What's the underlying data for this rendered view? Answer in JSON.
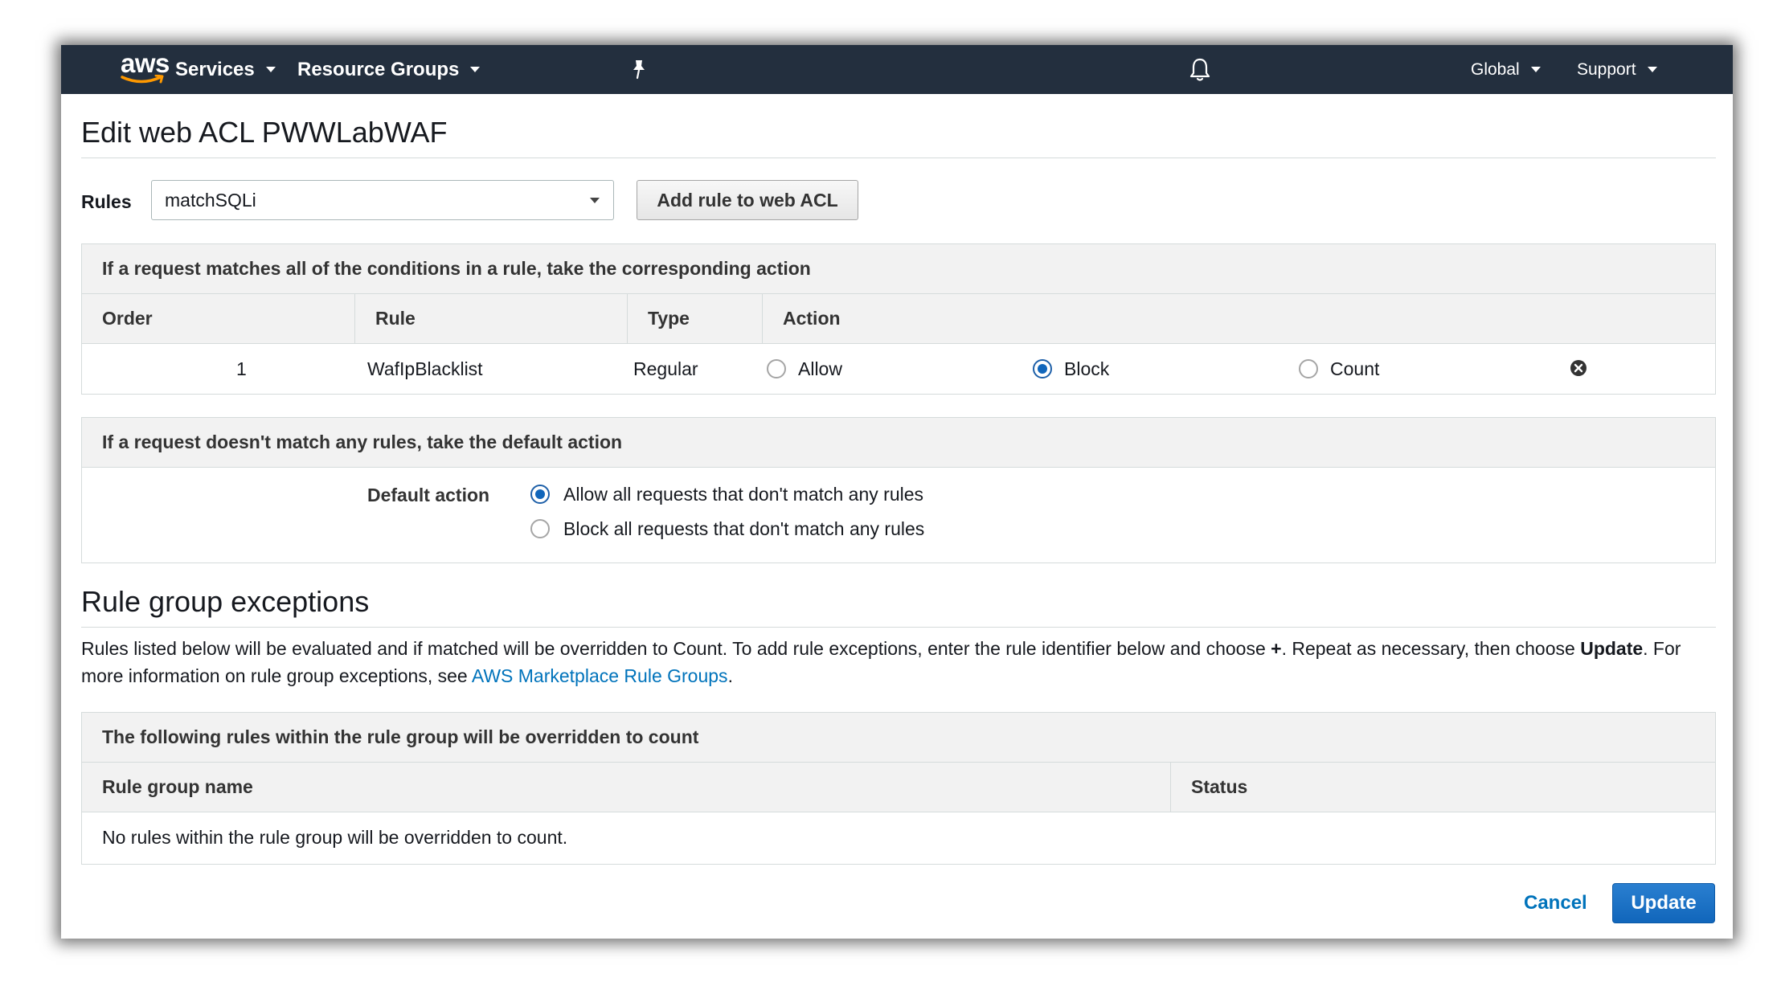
{
  "nav": {
    "logo_text": "aws",
    "services": "Services",
    "resource_groups": "Resource Groups",
    "region": "Global",
    "support": "Support"
  },
  "page": {
    "title": "Edit web ACL PWWLabWAF",
    "rules_label": "Rules",
    "rules_select_value": "matchSQLi",
    "add_rule_button": "Add rule to web ACL"
  },
  "rules_panel": {
    "heading": "If a request matches all of the conditions in a rule, take the corresponding action",
    "columns": [
      "Order",
      "Rule",
      "Type",
      "Action"
    ],
    "rows": [
      {
        "order": "1",
        "rule": "WafIpBlacklist",
        "type": "Regular",
        "actions": [
          "Allow",
          "Block",
          "Count"
        ],
        "selected_action": "Block"
      }
    ]
  },
  "default_panel": {
    "heading": "If a request doesn't match any rules, take the default action",
    "label": "Default action",
    "options": [
      "Allow all requests that don't match any rules",
      "Block all requests that don't match any rules"
    ],
    "selected": "Allow all requests that don't match any rules"
  },
  "exceptions": {
    "title": "Rule group exceptions",
    "text_1": "Rules listed below will be evaluated and if matched will be overridden to Count. To add rule exceptions, enter the rule identifier below and choose ",
    "text_plus": "+",
    "text_2": ". Repeat as necessary, then choose ",
    "text_update": "Update",
    "text_3": ". For more information on rule group exceptions, see ",
    "link_text": "AWS Marketplace Rule Groups",
    "text_end": ".",
    "panel_heading": "The following rules within the rule group will be overridden to count",
    "columns": [
      "Rule group name",
      "Status"
    ],
    "empty_message": "No rules within the rule group will be overridden to count."
  },
  "footer": {
    "cancel": "Cancel",
    "update": "Update"
  },
  "colors": {
    "nav_bg": "#232f3e",
    "primary": "#1166bb",
    "link": "#0073bb",
    "aws_orange": "#ff9900"
  }
}
